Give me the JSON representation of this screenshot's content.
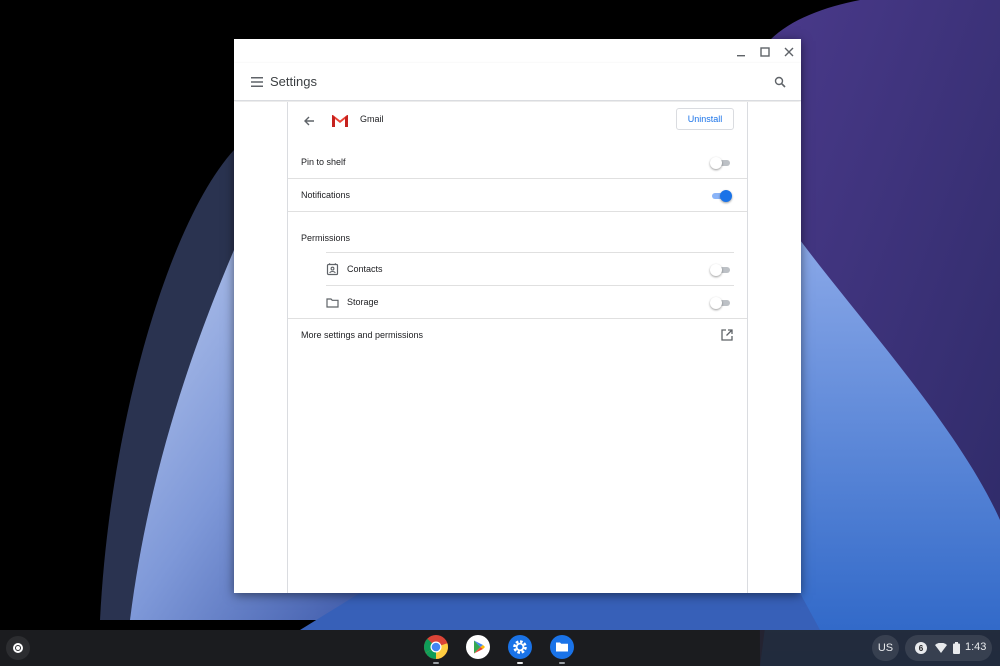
{
  "window": {
    "toolbar_title": "Settings"
  },
  "app": {
    "name": "Gmail",
    "uninstall_label": "Uninstall"
  },
  "settings": {
    "pin_to_shelf": {
      "label": "Pin to shelf",
      "enabled": false
    },
    "notifications": {
      "label": "Notifications",
      "enabled": true
    },
    "permissions_title": "Permissions",
    "permissions": [
      {
        "label": "Contacts",
        "icon": "contacts-icon",
        "enabled": false
      },
      {
        "label": "Storage",
        "icon": "folder-icon",
        "enabled": false
      }
    ],
    "more_settings_label": "More settings and permissions"
  },
  "shelf": {
    "apps": [
      "Chrome",
      "Play Store",
      "Settings",
      "Files"
    ],
    "ime": "US",
    "notification_count": "6",
    "time": "1:43"
  },
  "colors": {
    "accent": "#1a73e8",
    "toggle_on_track": "#8ab4f8",
    "toggle_off_track": "#bdc1c6"
  }
}
